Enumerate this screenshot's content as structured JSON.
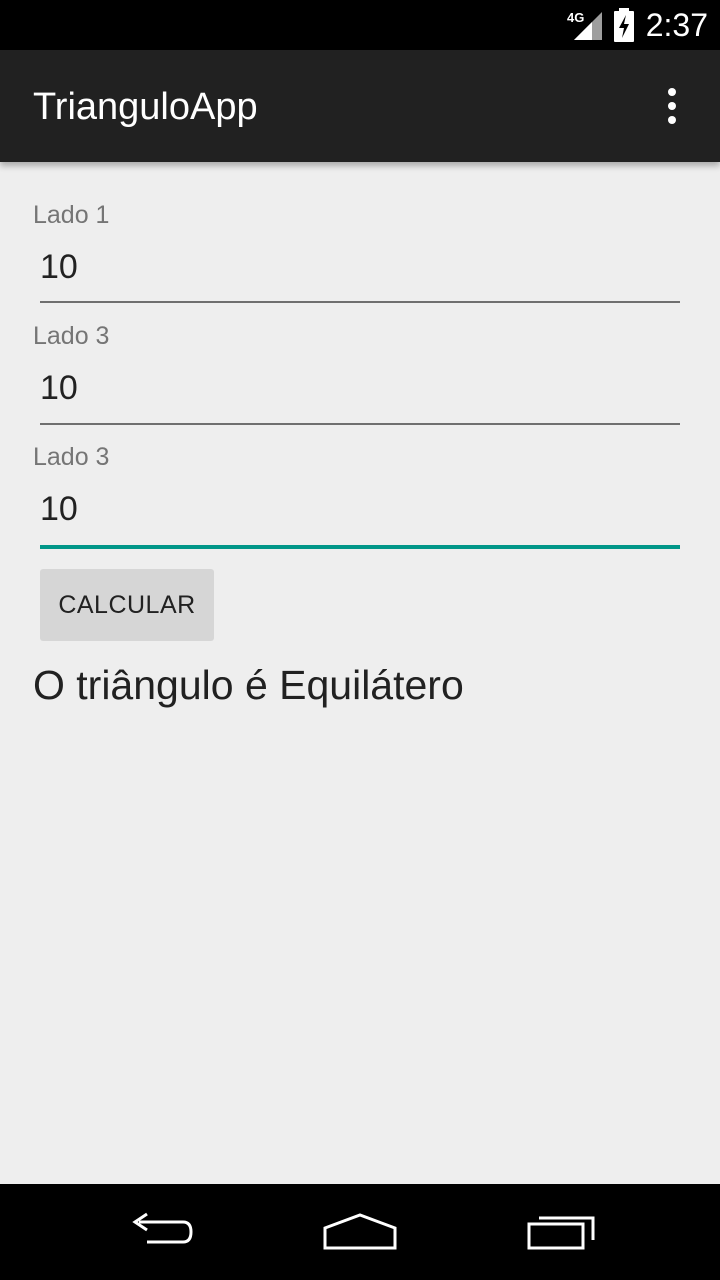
{
  "status_bar": {
    "time": "2:37",
    "network": "4G",
    "icons": [
      "signal-4g-icon",
      "battery-charging-icon"
    ]
  },
  "action_bar": {
    "title": "TrianguloApp",
    "overflow_icon": "more-vert-icon"
  },
  "form": {
    "fields": [
      {
        "label": "Lado 1",
        "value": "10",
        "focused": false
      },
      {
        "label": "Lado 3",
        "value": "10",
        "focused": false
      },
      {
        "label": "Lado 3",
        "value": "10",
        "focused": true
      }
    ],
    "button_label": "CALCULAR"
  },
  "result": "O triângulo é Equilátero",
  "colors": {
    "action_bar": "#212121",
    "background": "#eeeeee",
    "accent": "#009688",
    "button": "#d6d6d6"
  },
  "navigation": {
    "icons": [
      "back-icon",
      "home-icon",
      "recents-icon"
    ]
  }
}
